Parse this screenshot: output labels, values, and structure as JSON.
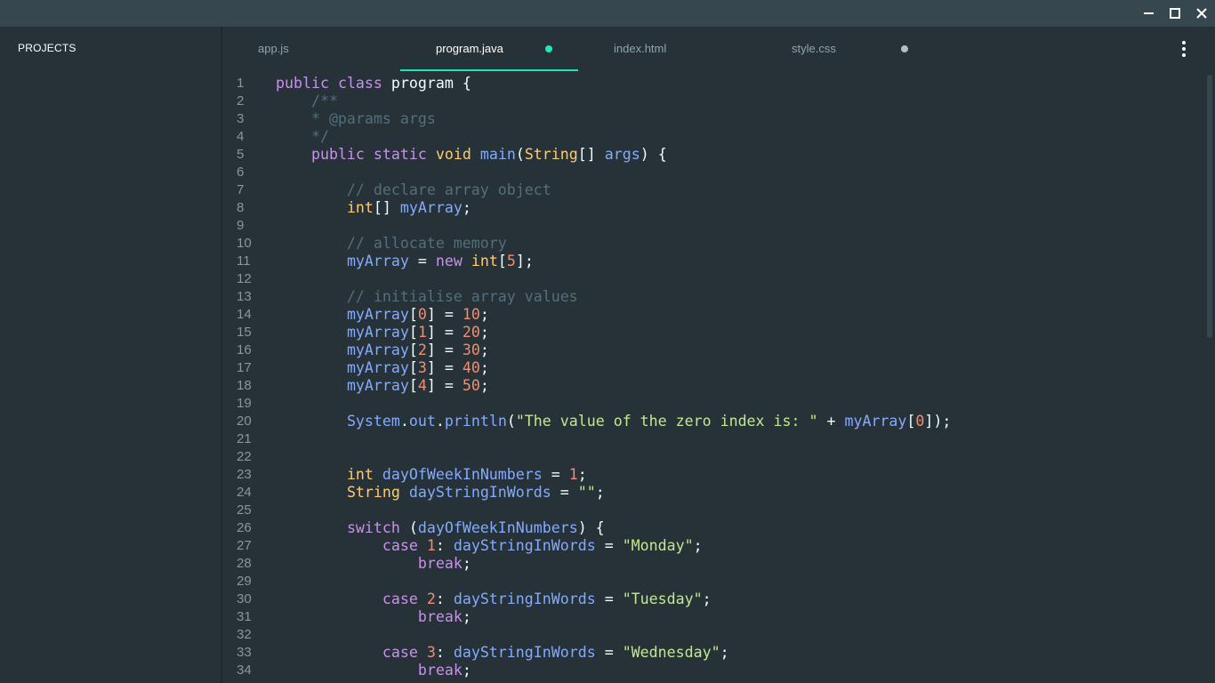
{
  "window": {
    "minimize_icon": "minimize-icon",
    "maximize_icon": "maximize-icon",
    "close_icon": "close-icon"
  },
  "sidebar": {
    "title": "PROJECTS"
  },
  "tabs": [
    {
      "label": "app.js",
      "active": false,
      "dot": null
    },
    {
      "label": "program.java",
      "active": true,
      "dot": "#1de9b6"
    },
    {
      "label": "index.html",
      "active": false,
      "dot": null
    },
    {
      "label": "style.css",
      "active": false,
      "dot": "#b0bec5"
    }
  ],
  "menu_icon": "more-vertical-icon",
  "colors": {
    "background": "#263238",
    "titlebar": "#37474f",
    "accent": "#1de9b6",
    "keyword": "#c792ea",
    "type": "#ffcb6b",
    "function": "#82aaff",
    "number": "#f78c6c",
    "string": "#c3e88d",
    "comment": "#546e7a"
  },
  "code_lines": [
    [
      [
        "kw",
        "public"
      ],
      [
        "p",
        " "
      ],
      [
        "kw",
        "class"
      ],
      [
        "p",
        " program {"
      ]
    ],
    [
      [
        "c",
        "    /**"
      ]
    ],
    [
      [
        "c",
        "    * @params args"
      ]
    ],
    [
      [
        "c",
        "    */"
      ]
    ],
    [
      [
        "p",
        "    "
      ],
      [
        "kw",
        "public"
      ],
      [
        "p",
        " "
      ],
      [
        "kw",
        "static"
      ],
      [
        "p",
        " "
      ],
      [
        "ty",
        "void"
      ],
      [
        "p",
        " "
      ],
      [
        "fn",
        "main"
      ],
      [
        "p",
        "("
      ],
      [
        "ty",
        "String"
      ],
      [
        "p",
        "[] "
      ],
      [
        "v",
        "args"
      ],
      [
        "p",
        ") {"
      ]
    ],
    [],
    [
      [
        "c",
        "        // declare array object"
      ]
    ],
    [
      [
        "p",
        "        "
      ],
      [
        "ty",
        "int"
      ],
      [
        "p",
        "[] "
      ],
      [
        "v",
        "myArray"
      ],
      [
        "p",
        ";"
      ]
    ],
    [],
    [
      [
        "c",
        "        // allocate memory"
      ]
    ],
    [
      [
        "p",
        "        "
      ],
      [
        "v",
        "myArray"
      ],
      [
        "p",
        " = "
      ],
      [
        "kw",
        "new"
      ],
      [
        "p",
        " "
      ],
      [
        "ty",
        "int"
      ],
      [
        "p",
        "["
      ],
      [
        "n",
        "5"
      ],
      [
        "p",
        "];"
      ]
    ],
    [],
    [
      [
        "c",
        "        // initialise array values"
      ]
    ],
    [
      [
        "p",
        "        "
      ],
      [
        "v",
        "myArray"
      ],
      [
        "p",
        "["
      ],
      [
        "n",
        "0"
      ],
      [
        "p",
        "] = "
      ],
      [
        "n",
        "10"
      ],
      [
        "p",
        ";"
      ]
    ],
    [
      [
        "p",
        "        "
      ],
      [
        "v",
        "myArray"
      ],
      [
        "p",
        "["
      ],
      [
        "n",
        "1"
      ],
      [
        "p",
        "] = "
      ],
      [
        "n",
        "20"
      ],
      [
        "p",
        ";"
      ]
    ],
    [
      [
        "p",
        "        "
      ],
      [
        "v",
        "myArray"
      ],
      [
        "p",
        "["
      ],
      [
        "n",
        "2"
      ],
      [
        "p",
        "] = "
      ],
      [
        "n",
        "30"
      ],
      [
        "p",
        ";"
      ]
    ],
    [
      [
        "p",
        "        "
      ],
      [
        "v",
        "myArray"
      ],
      [
        "p",
        "["
      ],
      [
        "n",
        "3"
      ],
      [
        "p",
        "] = "
      ],
      [
        "n",
        "40"
      ],
      [
        "p",
        ";"
      ]
    ],
    [
      [
        "p",
        "        "
      ],
      [
        "v",
        "myArray"
      ],
      [
        "p",
        "["
      ],
      [
        "n",
        "4"
      ],
      [
        "p",
        "] = "
      ],
      [
        "n",
        "50"
      ],
      [
        "p",
        ";"
      ]
    ],
    [],
    [
      [
        "p",
        "        "
      ],
      [
        "v",
        "System"
      ],
      [
        "p",
        "."
      ],
      [
        "v",
        "out"
      ],
      [
        "p",
        "."
      ],
      [
        "fn",
        "println"
      ],
      [
        "p",
        "("
      ],
      [
        "s",
        "\"The value of the zero index is: \""
      ],
      [
        "p",
        " + "
      ],
      [
        "v",
        "myArray"
      ],
      [
        "p",
        "["
      ],
      [
        "n",
        "0"
      ],
      [
        "p",
        "]);"
      ]
    ],
    [],
    [],
    [
      [
        "p",
        "        "
      ],
      [
        "ty",
        "int"
      ],
      [
        "p",
        " "
      ],
      [
        "v",
        "dayOfWeekInNumbers"
      ],
      [
        "p",
        " = "
      ],
      [
        "n",
        "1"
      ],
      [
        "p",
        ";"
      ]
    ],
    [
      [
        "p",
        "        "
      ],
      [
        "ty",
        "String"
      ],
      [
        "p",
        " "
      ],
      [
        "v",
        "dayStringInWords"
      ],
      [
        "p",
        " = "
      ],
      [
        "s",
        "\"\""
      ],
      [
        "p",
        ";"
      ]
    ],
    [],
    [
      [
        "p",
        "        "
      ],
      [
        "kw",
        "switch"
      ],
      [
        "p",
        " ("
      ],
      [
        "v",
        "dayOfWeekInNumbers"
      ],
      [
        "p",
        ") {"
      ]
    ],
    [
      [
        "p",
        "            "
      ],
      [
        "kw",
        "case"
      ],
      [
        "p",
        " "
      ],
      [
        "n",
        "1"
      ],
      [
        "p",
        ": "
      ],
      [
        "v",
        "dayStringInWords"
      ],
      [
        "p",
        " = "
      ],
      [
        "s",
        "\"Monday\""
      ],
      [
        "p",
        ";"
      ]
    ],
    [
      [
        "p",
        "                "
      ],
      [
        "kw",
        "break"
      ],
      [
        "p",
        ";"
      ]
    ],
    [],
    [
      [
        "p",
        "            "
      ],
      [
        "kw",
        "case"
      ],
      [
        "p",
        " "
      ],
      [
        "n",
        "2"
      ],
      [
        "p",
        ": "
      ],
      [
        "v",
        "dayStringInWords"
      ],
      [
        "p",
        " = "
      ],
      [
        "s",
        "\"Tuesday\""
      ],
      [
        "p",
        ";"
      ]
    ],
    [
      [
        "p",
        "                "
      ],
      [
        "kw",
        "break"
      ],
      [
        "p",
        ";"
      ]
    ],
    [],
    [
      [
        "p",
        "            "
      ],
      [
        "kw",
        "case"
      ],
      [
        "p",
        " "
      ],
      [
        "n",
        "3"
      ],
      [
        "p",
        ": "
      ],
      [
        "v",
        "dayStringInWords"
      ],
      [
        "p",
        " = "
      ],
      [
        "s",
        "\"Wednesday\""
      ],
      [
        "p",
        ";"
      ]
    ],
    [
      [
        "p",
        "                "
      ],
      [
        "kw",
        "break"
      ],
      [
        "p",
        ";"
      ]
    ]
  ]
}
